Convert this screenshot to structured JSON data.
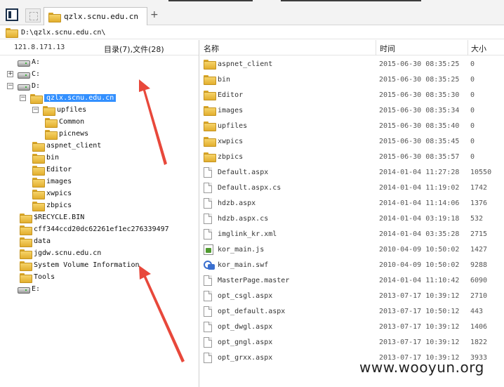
{
  "window": {
    "tab_title": "qzlx.scnu.edu.cn",
    "tab_add": "+",
    "path": "D:\\qzlx.scnu.edu.cn\\"
  },
  "left_panel": {
    "ip": "121.8.171.13",
    "counts": "目录(7),文件(28)",
    "tree": [
      {
        "label": "A:",
        "type": "drive",
        "expander": "",
        "selected": false
      },
      {
        "label": "C:",
        "type": "drive",
        "expander": "+",
        "selected": false
      },
      {
        "label": "D:",
        "type": "drive",
        "expander": "−",
        "selected": false
      },
      {
        "label": "qzlx.scnu.edu.cn",
        "type": "folder",
        "expander": "−",
        "selected": true
      },
      {
        "label": "upfiles",
        "type": "folder",
        "expander": "−",
        "selected": false
      },
      {
        "label": "Common",
        "type": "folder",
        "expander": "",
        "selected": false
      },
      {
        "label": "picnews",
        "type": "folder",
        "expander": "",
        "selected": false
      },
      {
        "label": "aspnet_client",
        "type": "folder",
        "expander": "",
        "selected": false
      },
      {
        "label": "bin",
        "type": "folder",
        "expander": "",
        "selected": false
      },
      {
        "label": "Editor",
        "type": "folder",
        "expander": "",
        "selected": false
      },
      {
        "label": "images",
        "type": "folder",
        "expander": "",
        "selected": false
      },
      {
        "label": "xwpics",
        "type": "folder",
        "expander": "",
        "selected": false
      },
      {
        "label": "zbpics",
        "type": "folder",
        "expander": "",
        "selected": false
      },
      {
        "label": "$RECYCLE.BIN",
        "type": "folder",
        "expander": "",
        "selected": false
      },
      {
        "label": "cff344ccd20dc62261ef1ec276339497",
        "type": "folder",
        "expander": "",
        "selected": false
      },
      {
        "label": "data",
        "type": "folder",
        "expander": "",
        "selected": false
      },
      {
        "label": "jgdw.scnu.edu.cn",
        "type": "folder",
        "expander": "",
        "selected": false
      },
      {
        "label": "System Volume Information",
        "type": "folder",
        "expander": "",
        "selected": false
      },
      {
        "label": "Tools",
        "type": "folder",
        "expander": "",
        "selected": false
      },
      {
        "label": "E:",
        "type": "drive",
        "expander": "",
        "selected": false
      }
    ]
  },
  "file_list": {
    "columns": {
      "name": "名称",
      "time": "时间",
      "size": "大小"
    },
    "rows": [
      {
        "name": "aspnet_client",
        "time": "2015-06-30 08:35:25",
        "size": "0",
        "icon": "folder-icon"
      },
      {
        "name": "bin",
        "time": "2015-06-30 08:35:25",
        "size": "0",
        "icon": "folder-icon"
      },
      {
        "name": "Editor",
        "time": "2015-06-30 08:35:30",
        "size": "0",
        "icon": "folder-icon"
      },
      {
        "name": "images",
        "time": "2015-06-30 08:35:34",
        "size": "0",
        "icon": "folder-icon"
      },
      {
        "name": "upfiles",
        "time": "2015-06-30 08:35:40",
        "size": "0",
        "icon": "folder-icon"
      },
      {
        "name": "xwpics",
        "time": "2015-06-30 08:35:45",
        "size": "0",
        "icon": "folder-icon"
      },
      {
        "name": "zbpics",
        "time": "2015-06-30 08:35:57",
        "size": "0",
        "icon": "folder-icon"
      },
      {
        "name": "Default.aspx",
        "time": "2014-01-04 11:27:28",
        "size": "10550",
        "icon": "file-icon"
      },
      {
        "name": "Default.aspx.cs",
        "time": "2014-01-04 11:19:02",
        "size": "1742",
        "icon": "file-icon"
      },
      {
        "name": "hdzb.aspx",
        "time": "2014-01-04 11:14:06",
        "size": "1376",
        "icon": "file-icon"
      },
      {
        "name": "hdzb.aspx.cs",
        "time": "2014-01-04 03:19:18",
        "size": "532",
        "icon": "file-icon"
      },
      {
        "name": "imglink_kr.xml",
        "time": "2014-01-04 03:35:28",
        "size": "2715",
        "icon": "file-icon"
      },
      {
        "name": "kor_main.js",
        "time": "2010-04-09 10:50:02",
        "size": "1427",
        "icon": "js-file-icon"
      },
      {
        "name": "kor_main.swf",
        "time": "2010-04-09 10:50:02",
        "size": "9288",
        "icon": "swf-file-icon"
      },
      {
        "name": "MasterPage.master",
        "time": "2014-01-04 11:10:42",
        "size": "6090",
        "icon": "file-icon"
      },
      {
        "name": "opt_csgl.aspx",
        "time": "2013-07-17 10:39:12",
        "size": "2710",
        "icon": "file-icon"
      },
      {
        "name": "opt_default.aspx",
        "time": "2013-07-17 10:50:12",
        "size": "443",
        "icon": "file-icon"
      },
      {
        "name": "opt_dwgl.aspx",
        "time": "2013-07-17 10:39:12",
        "size": "1406",
        "icon": "file-icon"
      },
      {
        "name": "opt_gngl.aspx",
        "time": "2013-07-17 10:39:12",
        "size": "1822",
        "icon": "file-icon"
      },
      {
        "name": "opt_grxx.aspx",
        "time": "2013-07-17 10:39:12",
        "size": "3933",
        "icon": "file-icon"
      }
    ]
  },
  "watermark": "www.wooyun.org",
  "colors": {
    "selection": "#3390ff",
    "folder": "#f0c24a",
    "arrow": "#e8483b"
  }
}
